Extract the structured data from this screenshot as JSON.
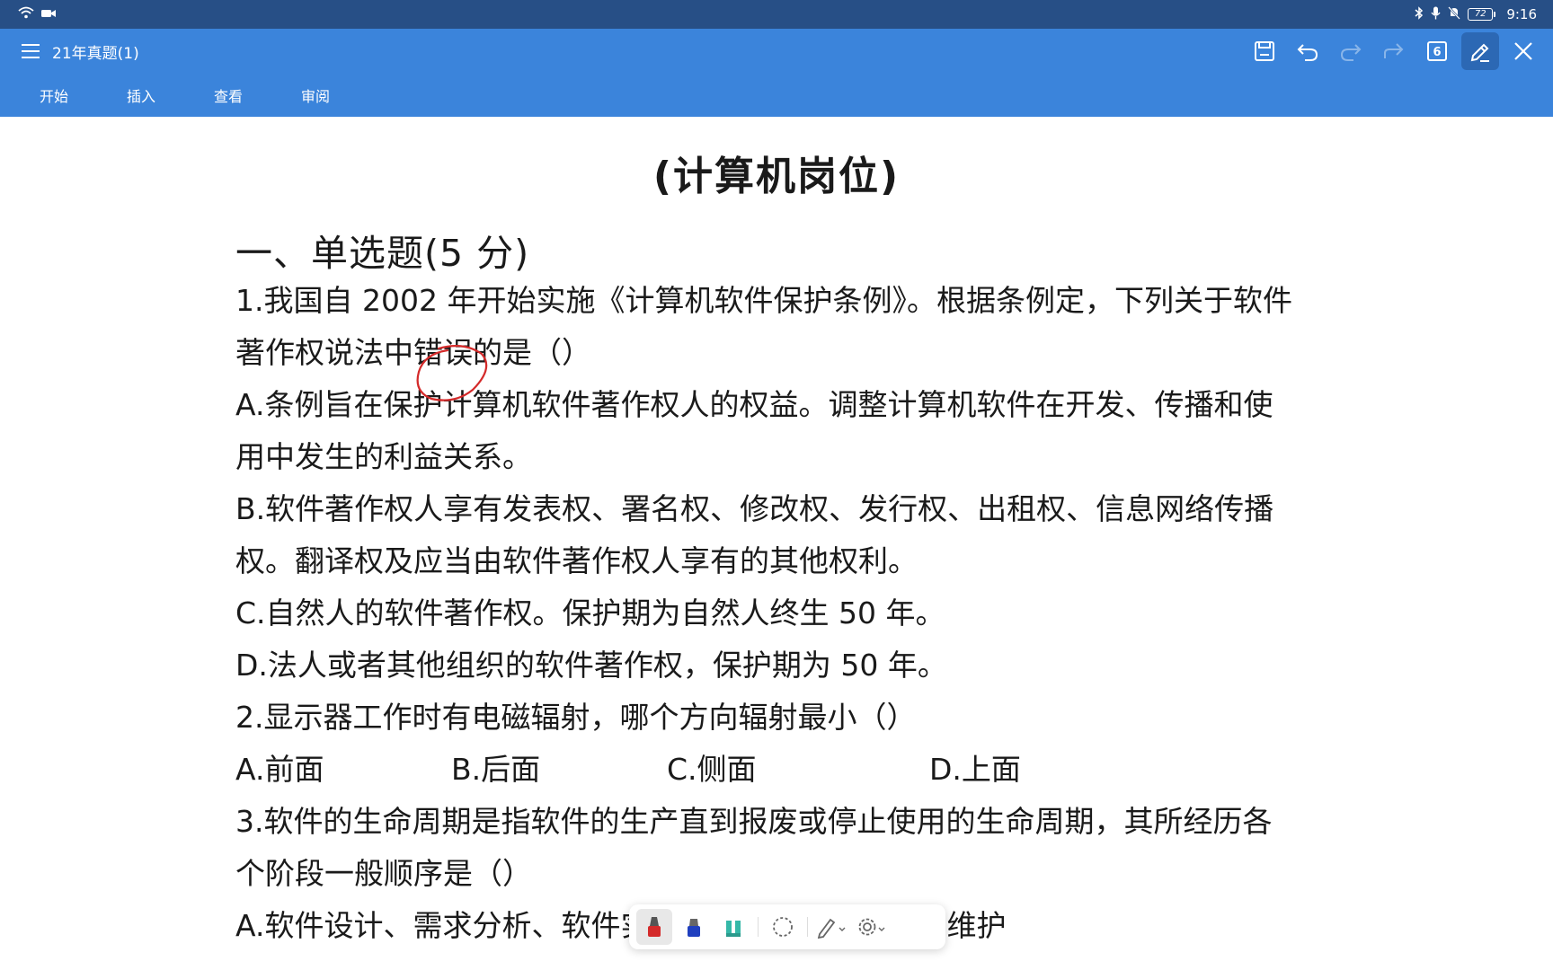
{
  "status_bar": {
    "time": "9:16",
    "battery": "72",
    "icons": [
      "wifi-icon",
      "camera-icon",
      "bluetooth-icon",
      "mic-icon",
      "mute-icon",
      "battery-icon"
    ]
  },
  "header": {
    "doc_title": "21年真题(1)",
    "tabs": [
      {
        "label": "开始"
      },
      {
        "label": "插入"
      },
      {
        "label": "查看"
      },
      {
        "label": "审阅"
      }
    ],
    "toolbar_icons": [
      "save-icon",
      "undo-icon",
      "redo-icon",
      "share-icon",
      "page-count-icon",
      "pen-edit-icon",
      "close-icon"
    ],
    "page_count": "6",
    "accent_color": "#3b84db",
    "status_color": "#274f86"
  },
  "document": {
    "heading": "(计算机岗位)",
    "section": "一、单选题(5 分)",
    "lines": [
      "1.我国自 2002 年开始实施《计算机软件保护条例》。根据条例定，下列关于软件",
      "著作权说法中错误的是（）",
      "A.条例旨在保护计算机软件著作权人的权益。调整计算机软件在开发、传播和使",
      "用中发生的利益关系。",
      "B.软件著作权人享有发表权、署名权、修改权、发行权、出租权、信息网络传播",
      "权。翻译权及应当由软件著作权人享有的其他权利。",
      "C.自然人的软件著作权。保护期为自然人终生 50 年。",
      "D.法人或者其他组织的软件著作权，保护期为 50 年。",
      "2.显示器工作时有电磁辐射，哪个方向辐射最小（）"
    ],
    "q2_options": [
      "A.前面",
      "B.后面",
      "C.侧面",
      "D.上面"
    ],
    "lines_after": [
      "3.软件的生命周期是指软件的生产直到报废或停止使用的生命周期，其所经历各",
      "个阶段一般顺序是（）",
      "A.软件设计、需求分析、软件实现、系统测试、运行和维护"
    ],
    "annotation_color": "#d42a2a"
  },
  "pen_toolbar": {
    "tools": [
      "red-pen-icon",
      "blue-marker-icon",
      "highlighter-icon",
      "lasso-icon",
      "pen-style-icon",
      "settings-icon"
    ]
  }
}
